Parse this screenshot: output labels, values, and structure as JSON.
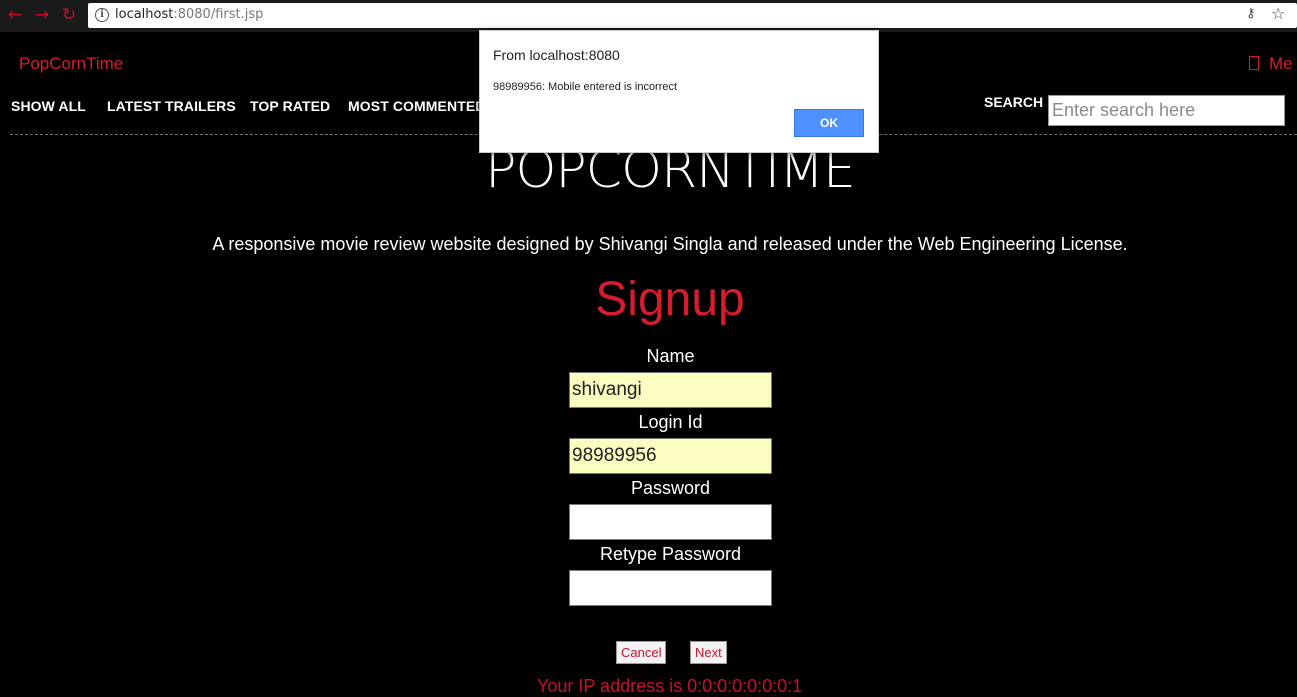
{
  "browser": {
    "url_host": "localhost",
    "url_rest": ":8080/first.jsp",
    "back_icon": "←",
    "forward_icon": "→",
    "reload_icon": "↻"
  },
  "header": {
    "brand": "PopCornTime",
    "menu_label": "Me"
  },
  "nav": {
    "items": [
      "SHOW ALL",
      "LATEST TRAILERS",
      "TOP RATED",
      "MOST COMMENTED"
    ],
    "search_label": "SEARCH",
    "search_placeholder": "Enter search here"
  },
  "main": {
    "site_title": "POPCORNTIME",
    "tagline": "A responsive movie review website designed by Shivangi Singla and released under the Web Engineering License.",
    "signup_title": "Signup",
    "fields": {
      "name_label": "Name",
      "name_value": "shivangi",
      "login_label": "Login Id",
      "login_value": "98989956",
      "password_label": "Password",
      "retype_label": "Retype Password"
    },
    "cancel_label": "Cancel",
    "next_label": "Next",
    "ip_text": "Your IP address is 0:0:0:0:0:0:0:1"
  },
  "dialog": {
    "title": "From localhost:8080",
    "message": "98989956: Mobile entered is incorrect",
    "ok_label": "OK"
  },
  "colors": {
    "accent_red": "#d61d2b",
    "background": "#000000",
    "autofill_yellow": "#fafcc0",
    "dialog_button": "#4d90fe"
  }
}
